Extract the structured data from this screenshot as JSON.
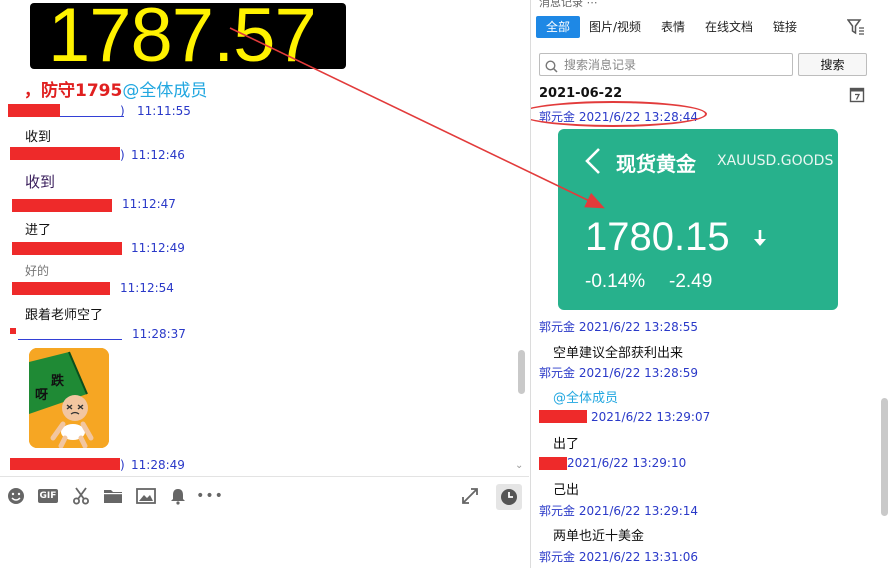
{
  "left_pane": {
    "price_display": {
      "value": "1787.57",
      "axis_tick_top": "19",
      "axis_tick_bottom": "19"
    },
    "hold_message": {
      "text": "，防守1795",
      "mention": "@全体成员"
    },
    "messages": [
      {
        "time": "11:11:55",
        "body": "收到"
      },
      {
        "time": "11:12:46",
        "body": "收到"
      },
      {
        "time": "11:12:47",
        "body": "进了"
      },
      {
        "time": "11:12:49",
        "body": "好的"
      },
      {
        "time": "11:12:54",
        "body": "跟着老师空了"
      },
      {
        "time": "11:28:37",
        "body": ""
      },
      {
        "time": "11:28:49",
        "body": ""
      }
    ],
    "sticker": {
      "icon": "crying-baby-sticker-icon",
      "char_1": "跌",
      "char_2": "呀"
    },
    "toolbar": {
      "gif_label": "GIF",
      "more_label": "•••",
      "icons": [
        "emoji-icon",
        "gif-icon",
        "scissors-icon",
        "folder-icon",
        "image-icon",
        "bell-icon",
        "more-icon",
        "expand-icon",
        "history-clock-icon"
      ]
    }
  },
  "right_pane": {
    "title": "消息记录 ⋯",
    "tabs": [
      {
        "label": "全部",
        "active": true
      },
      {
        "label": "图片/视频",
        "active": false
      },
      {
        "label": "表情",
        "active": false
      },
      {
        "label": "在线文档",
        "active": false
      },
      {
        "label": "链接",
        "active": false
      }
    ],
    "search": {
      "placeholder": "搜索消息记录",
      "button_label": "搜索"
    },
    "date_header": "2021-06-22",
    "card": {
      "title": "现货黄金",
      "code": "XAUUSD.GOODS",
      "price": "1780.15",
      "change_pct": "-0.14%",
      "change_abs": "-2.49",
      "trend": "down"
    },
    "entries": [
      {
        "meta": "郭元金 2021/6/22 13:28:44",
        "body": ""
      },
      {
        "meta": "郭元金 2021/6/22 13:28:55",
        "body": "空单建议全部获利出来"
      },
      {
        "meta": "郭元金 2021/6/22 13:28:59",
        "body": "@全体成员"
      },
      {
        "meta": "2021/6/22 13:29:07",
        "body": "出了"
      },
      {
        "meta": "2021/6/22 13:29:10",
        "body": "己出"
      },
      {
        "meta": "郭元金 2021/6/22 13:29:14",
        "body": "两单也近十美金"
      },
      {
        "meta": "郭元金 2021/6/22 13:31:06",
        "body": ""
      }
    ]
  },
  "colors": {
    "price_yellow": "#fff200",
    "alert_red": "#e02020",
    "mention_blue": "#22a7e0",
    "meta_blue": "#2a39c8",
    "tab_active": "#1e88e5",
    "card_green": "#27b18c",
    "annotation_red": "#e23b3b"
  }
}
